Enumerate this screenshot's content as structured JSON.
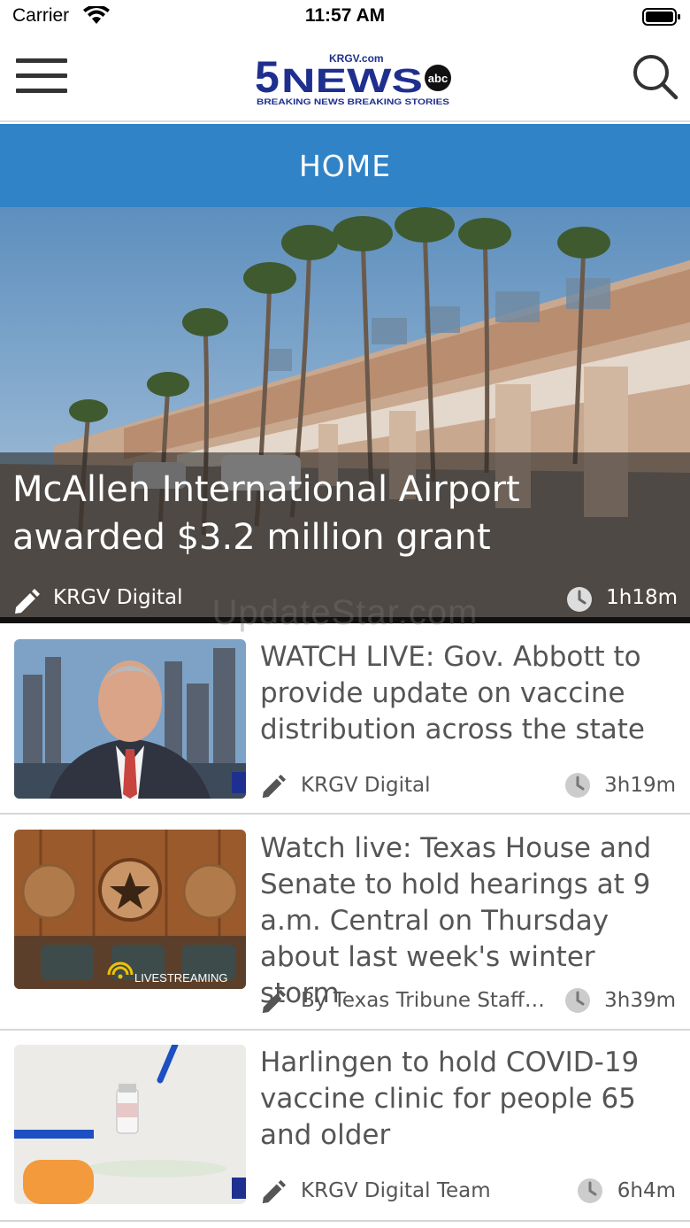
{
  "status_bar": {
    "carrier": "Carrier",
    "time": "11:57 AM"
  },
  "header": {
    "logo_top_text": "KRGV.com",
    "logo_number": "5",
    "logo_word": "NEWS",
    "logo_network": "abc",
    "logo_tagline": "BREAKING NEWS BREAKING STORIES",
    "menu_icon": "hamburger-icon",
    "search_icon": "search-icon"
  },
  "section": {
    "title": "HOME"
  },
  "hero": {
    "title": "McAllen International Airport awarded $3.2 million grant",
    "author": "KRGV Digital",
    "time": "1h18m"
  },
  "watermark": "UpdateStar.com",
  "articles": [
    {
      "title": "WATCH LIVE: Gov. Abbott to provide update on vaccine distribution across the state",
      "author": "KRGV Digital",
      "time": "3h19m"
    },
    {
      "title": "Watch live: Texas House and Senate to hold hearings at 9 a.m. Central on Thursday about last week's winter storm",
      "author": "By Texas Tribune Staff,…",
      "time": "3h39m",
      "thumb_badge": "LIVESTREAMING"
    },
    {
      "title": "Harlingen to hold COVID-19 vaccine clinic for people 65 and older",
      "author": "KRGV Digital Team",
      "time": "6h4m"
    }
  ],
  "colors": {
    "brand_blue": "#3083c6",
    "logo_navy": "#1f2f8f"
  }
}
